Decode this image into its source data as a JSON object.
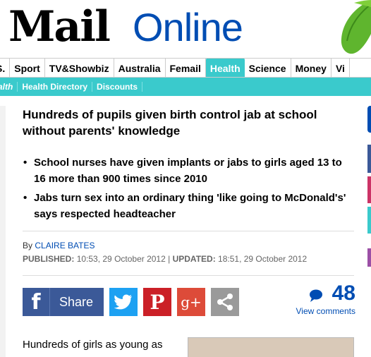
{
  "masthead": {
    "brand_mail": "Mail",
    "brand_online": "Online"
  },
  "nav": {
    "primary": [
      "S.",
      "Sport",
      "TV&Showbiz",
      "Australia",
      "Femail",
      "Health",
      "Science",
      "Money",
      "Vi"
    ],
    "active": "Health",
    "secondary": [
      "alth",
      "Health Directory",
      "Discounts"
    ]
  },
  "article": {
    "headline": "Hundreds of pupils given birth control jab at school without parents' knowledge",
    "bullets": [
      "School nurses have given implants or jabs to girls aged 13 to 16 more than 900 times since 2010",
      "Jabs turn sex into an ordinary thing 'like going to McDonald's' says respected headteacher"
    ],
    "byline_prefix": "By",
    "author": "CLAIRE BATES",
    "published_label": "PUBLISHED:",
    "published_value": "10:53, 29 October 2012",
    "separator": "|",
    "updated_label": "UPDATED:",
    "updated_value": "18:51, 29 October 2012",
    "body_start": "Hundreds of girls as young as"
  },
  "share": {
    "facebook_label": "Share",
    "colors": {
      "facebook": "#3b5998",
      "twitter": "#1da1f2",
      "pinterest": "#cb2027",
      "googleplus": "#dd4b39",
      "more": "#9a9a9a"
    },
    "icons": [
      "facebook-icon",
      "twitter-icon",
      "pinterest-icon",
      "googleplus-icon",
      "share-more-icon"
    ]
  },
  "comments": {
    "count": "48",
    "link": "View comments"
  },
  "colors": {
    "accent": "#3acacc",
    "link": "#004db3"
  }
}
